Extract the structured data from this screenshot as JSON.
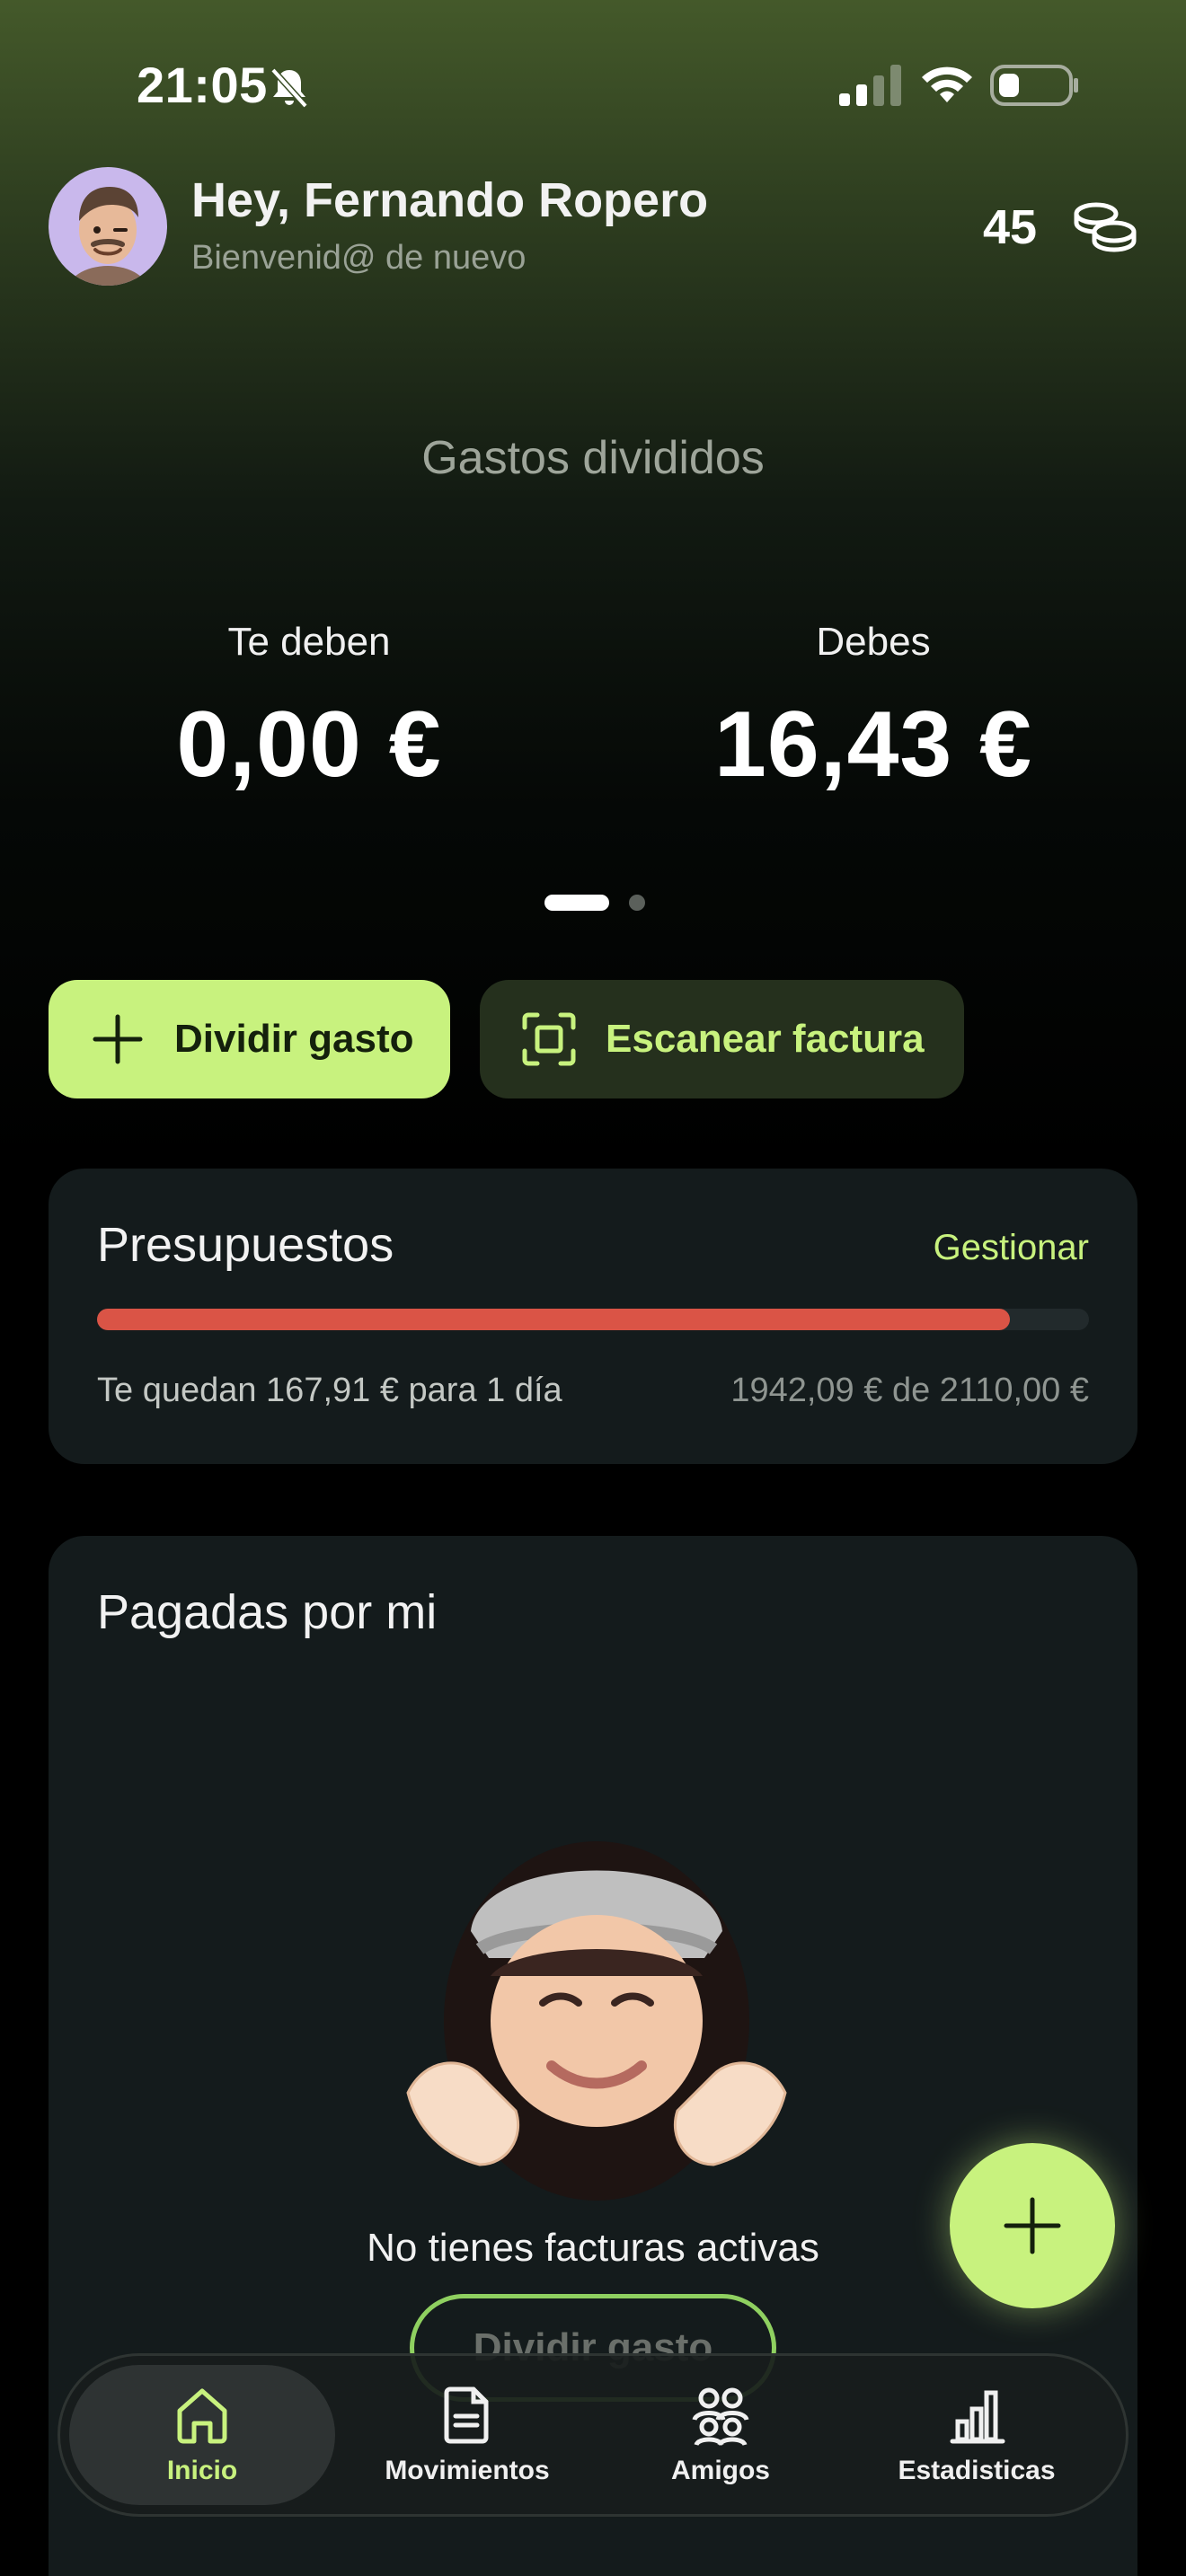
{
  "status_bar": {
    "time": "21:05",
    "icons": [
      "bell-slash-icon",
      "cellular-signal-icon",
      "wifi-icon",
      "battery-icon"
    ]
  },
  "header": {
    "greeting": "Hey, Fernando Ropero",
    "subtitle": "Bienvenid@ de nuevo",
    "coins": "45",
    "coins_icon": "coins-icon"
  },
  "balance": {
    "title": "Gastos divididos",
    "owed_to_you_label": "Te deben",
    "owed_to_you_value": "0,00 €",
    "you_owe_label": "Debes",
    "you_owe_value": "16,43 €",
    "page_index": 1,
    "page_count": 2
  },
  "actions": {
    "split_label": "Dividir gasto",
    "scan_label": "Escanear factura"
  },
  "budget": {
    "title": "Presupuestos",
    "manage_label": "Gestionar",
    "remaining_text": "Te quedan 167,91 € para 1 día",
    "spent_text": "1942,09 € de 2110,00 €",
    "progress_fraction": 0.92
  },
  "paid_by_me": {
    "title": "Pagadas por mi",
    "empty_text": "No tienes facturas activas",
    "button_label": "Dividir gasto"
  },
  "nav": {
    "items": [
      {
        "label": "Inicio",
        "icon": "home-icon",
        "active": true
      },
      {
        "label": "Movimientos",
        "icon": "document-icon",
        "active": false
      },
      {
        "label": "Amigos",
        "icon": "friends-icon",
        "active": false
      },
      {
        "label": "Estadisticas",
        "icon": "bar-chart-icon",
        "active": false
      }
    ]
  },
  "colors": {
    "accent": "#c8f27e",
    "budget_bar": "#da5446",
    "card_bg": "#141b1c"
  }
}
